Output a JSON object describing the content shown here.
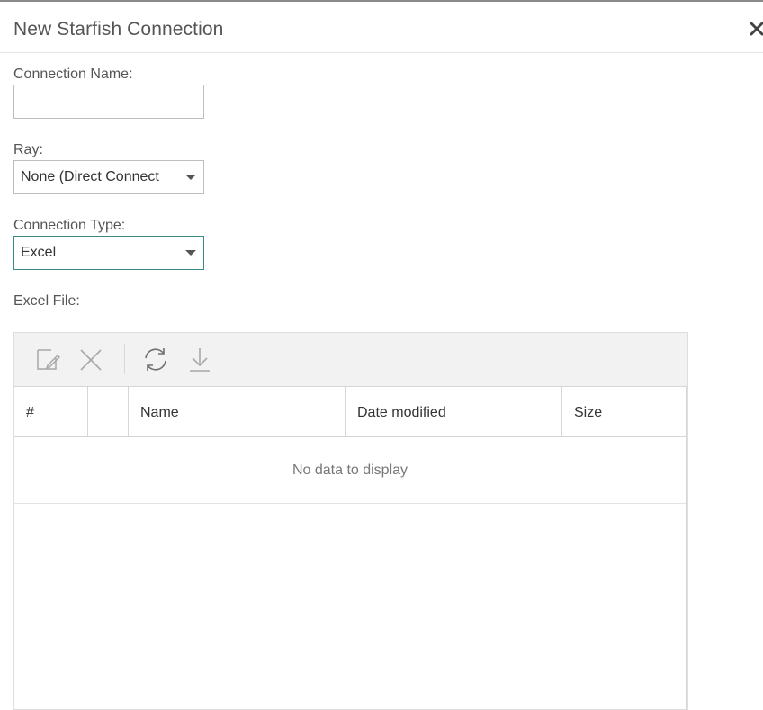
{
  "dialog": {
    "title": "New Starfish Connection",
    "close_icon": "close-icon"
  },
  "form": {
    "connection_name": {
      "label": "Connection Name:",
      "value": "",
      "placeholder": ""
    },
    "ray": {
      "label": "Ray:",
      "value": "None (Direct Connect"
    },
    "connection_type": {
      "label": "Connection Type:",
      "value": "Excel"
    },
    "excel_file": {
      "label": "Excel File:"
    }
  },
  "toolbar": {
    "icons": [
      "edit-icon",
      "delete-icon",
      "refresh-icon",
      "download-icon"
    ]
  },
  "table": {
    "columns": [
      "#",
      "",
      "Name",
      "Date modified",
      "Size"
    ],
    "empty_text": "No data to display"
  },
  "colors": {
    "focus_border": "#3a8a88",
    "toolbar_bg": "#f2f2f2",
    "label_text": "#555555"
  }
}
